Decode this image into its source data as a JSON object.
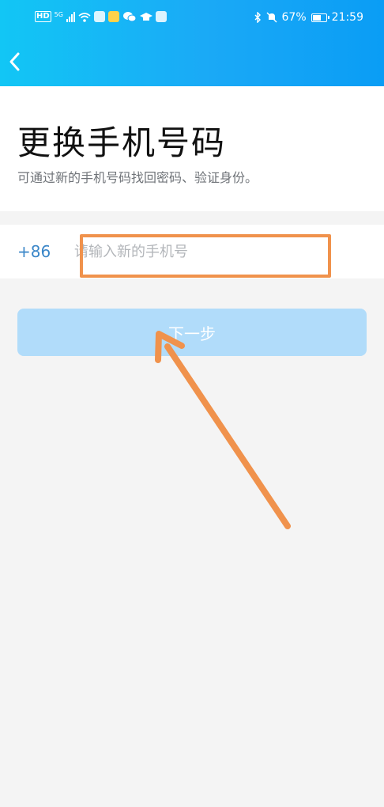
{
  "status_bar": {
    "network_badge": "HD",
    "network_type": "5G",
    "battery_percent": "67%",
    "battery_level": 0.67,
    "time": "21:59"
  },
  "nav": {
    "back_icon": "chevron-left-icon"
  },
  "header": {
    "title": "更换手机号码",
    "subtitle": "可通过新的手机号码找回密码、验证身份。"
  },
  "form": {
    "country_code": "+86",
    "phone_placeholder": "请输入新的手机号",
    "phone_value": ""
  },
  "next_button": {
    "label": "下一步"
  },
  "colors": {
    "topbar_start": "#12c6f5",
    "topbar_end": "#0a9df5",
    "accent": "#3a86c8",
    "button_disabled": "#b1dcfa",
    "annotation": "#f0924c"
  }
}
